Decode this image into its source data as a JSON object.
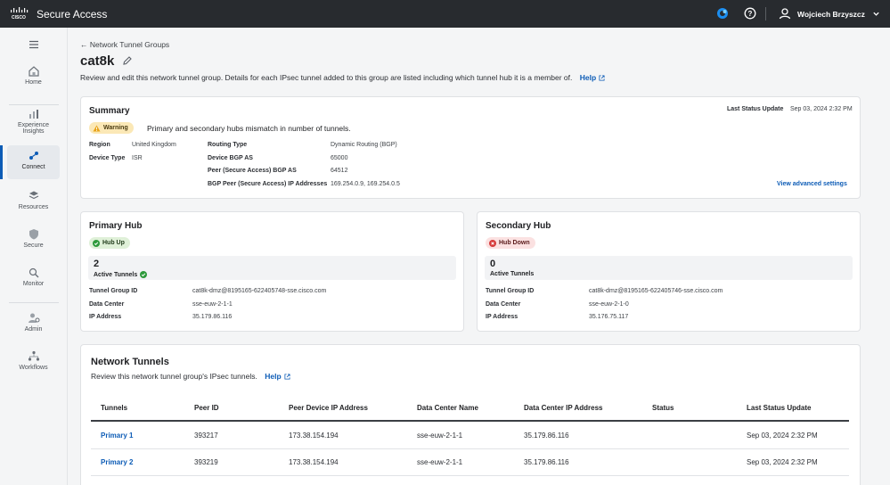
{
  "app": {
    "title": "Secure Access",
    "user": "Wojciech Brzyszcz"
  },
  "sidebar": {
    "items": [
      {
        "label": "Home",
        "icon": "home-icon"
      },
      {
        "label": "Experience Insights",
        "icon": "insights-icon"
      },
      {
        "label": "Connect",
        "icon": "connect-icon",
        "active": true
      },
      {
        "label": "Resources",
        "icon": "resources-icon"
      },
      {
        "label": "Secure",
        "icon": "shield-icon"
      },
      {
        "label": "Monitor",
        "icon": "monitor-icon"
      },
      {
        "label": "Admin",
        "icon": "admin-icon"
      },
      {
        "label": "Workflows",
        "icon": "workflows-icon"
      }
    ]
  },
  "page": {
    "breadcrumb": "Network Tunnel Groups",
    "title": "cat8k",
    "description": "Review and edit this network tunnel group. Details for each IPsec tunnel added to this group are listed including which tunnel hub it is a member of.",
    "help": "Help"
  },
  "summary": {
    "title": "Summary",
    "last_status_label": "Last Status Update",
    "last_status_value": "Sep 03, 2024 2:32 PM",
    "warning_badge": "Warning",
    "warning_text": "Primary and secondary hubs mismatch in number of tunnels.",
    "region_label": "Region",
    "region_value": "United Kingdom",
    "device_type_label": "Device Type",
    "device_type_value": "ISR",
    "routing_type_label": "Routing Type",
    "routing_type_value": "Dynamic Routing (BGP)",
    "device_bgp_label": "Device BGP AS",
    "device_bgp_value": "65000",
    "peer_bgp_label": "Peer (Secure Access) BGP AS",
    "peer_bgp_value": "64512",
    "bgp_peer_ip_label": "BGP Peer (Secure Access) IP Addresses",
    "bgp_peer_ip_value": "169.254.0.9, 169.254.0.5",
    "advanced_link": "View advanced settings"
  },
  "primary_hub": {
    "title": "Primary Hub",
    "status": "Hub Up",
    "count": "2",
    "count_label": "Active Tunnels",
    "tg_id_label": "Tunnel Group ID",
    "tg_id_value": "cat8k-dmz@8195165-622405748-sse.cisco.com",
    "dc_label": "Data Center",
    "dc_value": "sse-euw-2-1-1",
    "ip_label": "IP Address",
    "ip_value": "35.179.86.116"
  },
  "secondary_hub": {
    "title": "Secondary Hub",
    "status": "Hub Down",
    "count": "0",
    "count_label": "Active Tunnels",
    "tg_id_label": "Tunnel Group ID",
    "tg_id_value": "cat8k-dmz@8195165-622405746-sse.cisco.com",
    "dc_label": "Data Center",
    "dc_value": "sse-euw-2-1-0",
    "ip_label": "IP Address",
    "ip_value": "35.176.75.117"
  },
  "tunnels": {
    "title": "Network Tunnels",
    "description": "Review this network tunnel group's IPsec tunnels.",
    "help": "Help",
    "columns": [
      "Tunnels",
      "Peer ID",
      "Peer Device IP Address",
      "Data Center Name",
      "Data Center IP Address",
      "Status",
      "Last Status Update"
    ],
    "rows": [
      [
        "Primary 1",
        "393217",
        "173.38.154.194",
        "sse-euw-2-1-1",
        "35.179.86.116",
        "",
        "Sep 03, 2024 2:32 PM"
      ],
      [
        "Primary 2",
        "393219",
        "173.38.154.194",
        "sse-euw-2-1-1",
        "35.179.86.116",
        "",
        "Sep 03, 2024 2:32 PM"
      ]
    ]
  },
  "colors": {
    "topbar": "#282b2f",
    "link": "#0d5cb6",
    "success": "#2e9a3c",
    "danger": "#d63a3a",
    "warning": "#e8a317"
  }
}
